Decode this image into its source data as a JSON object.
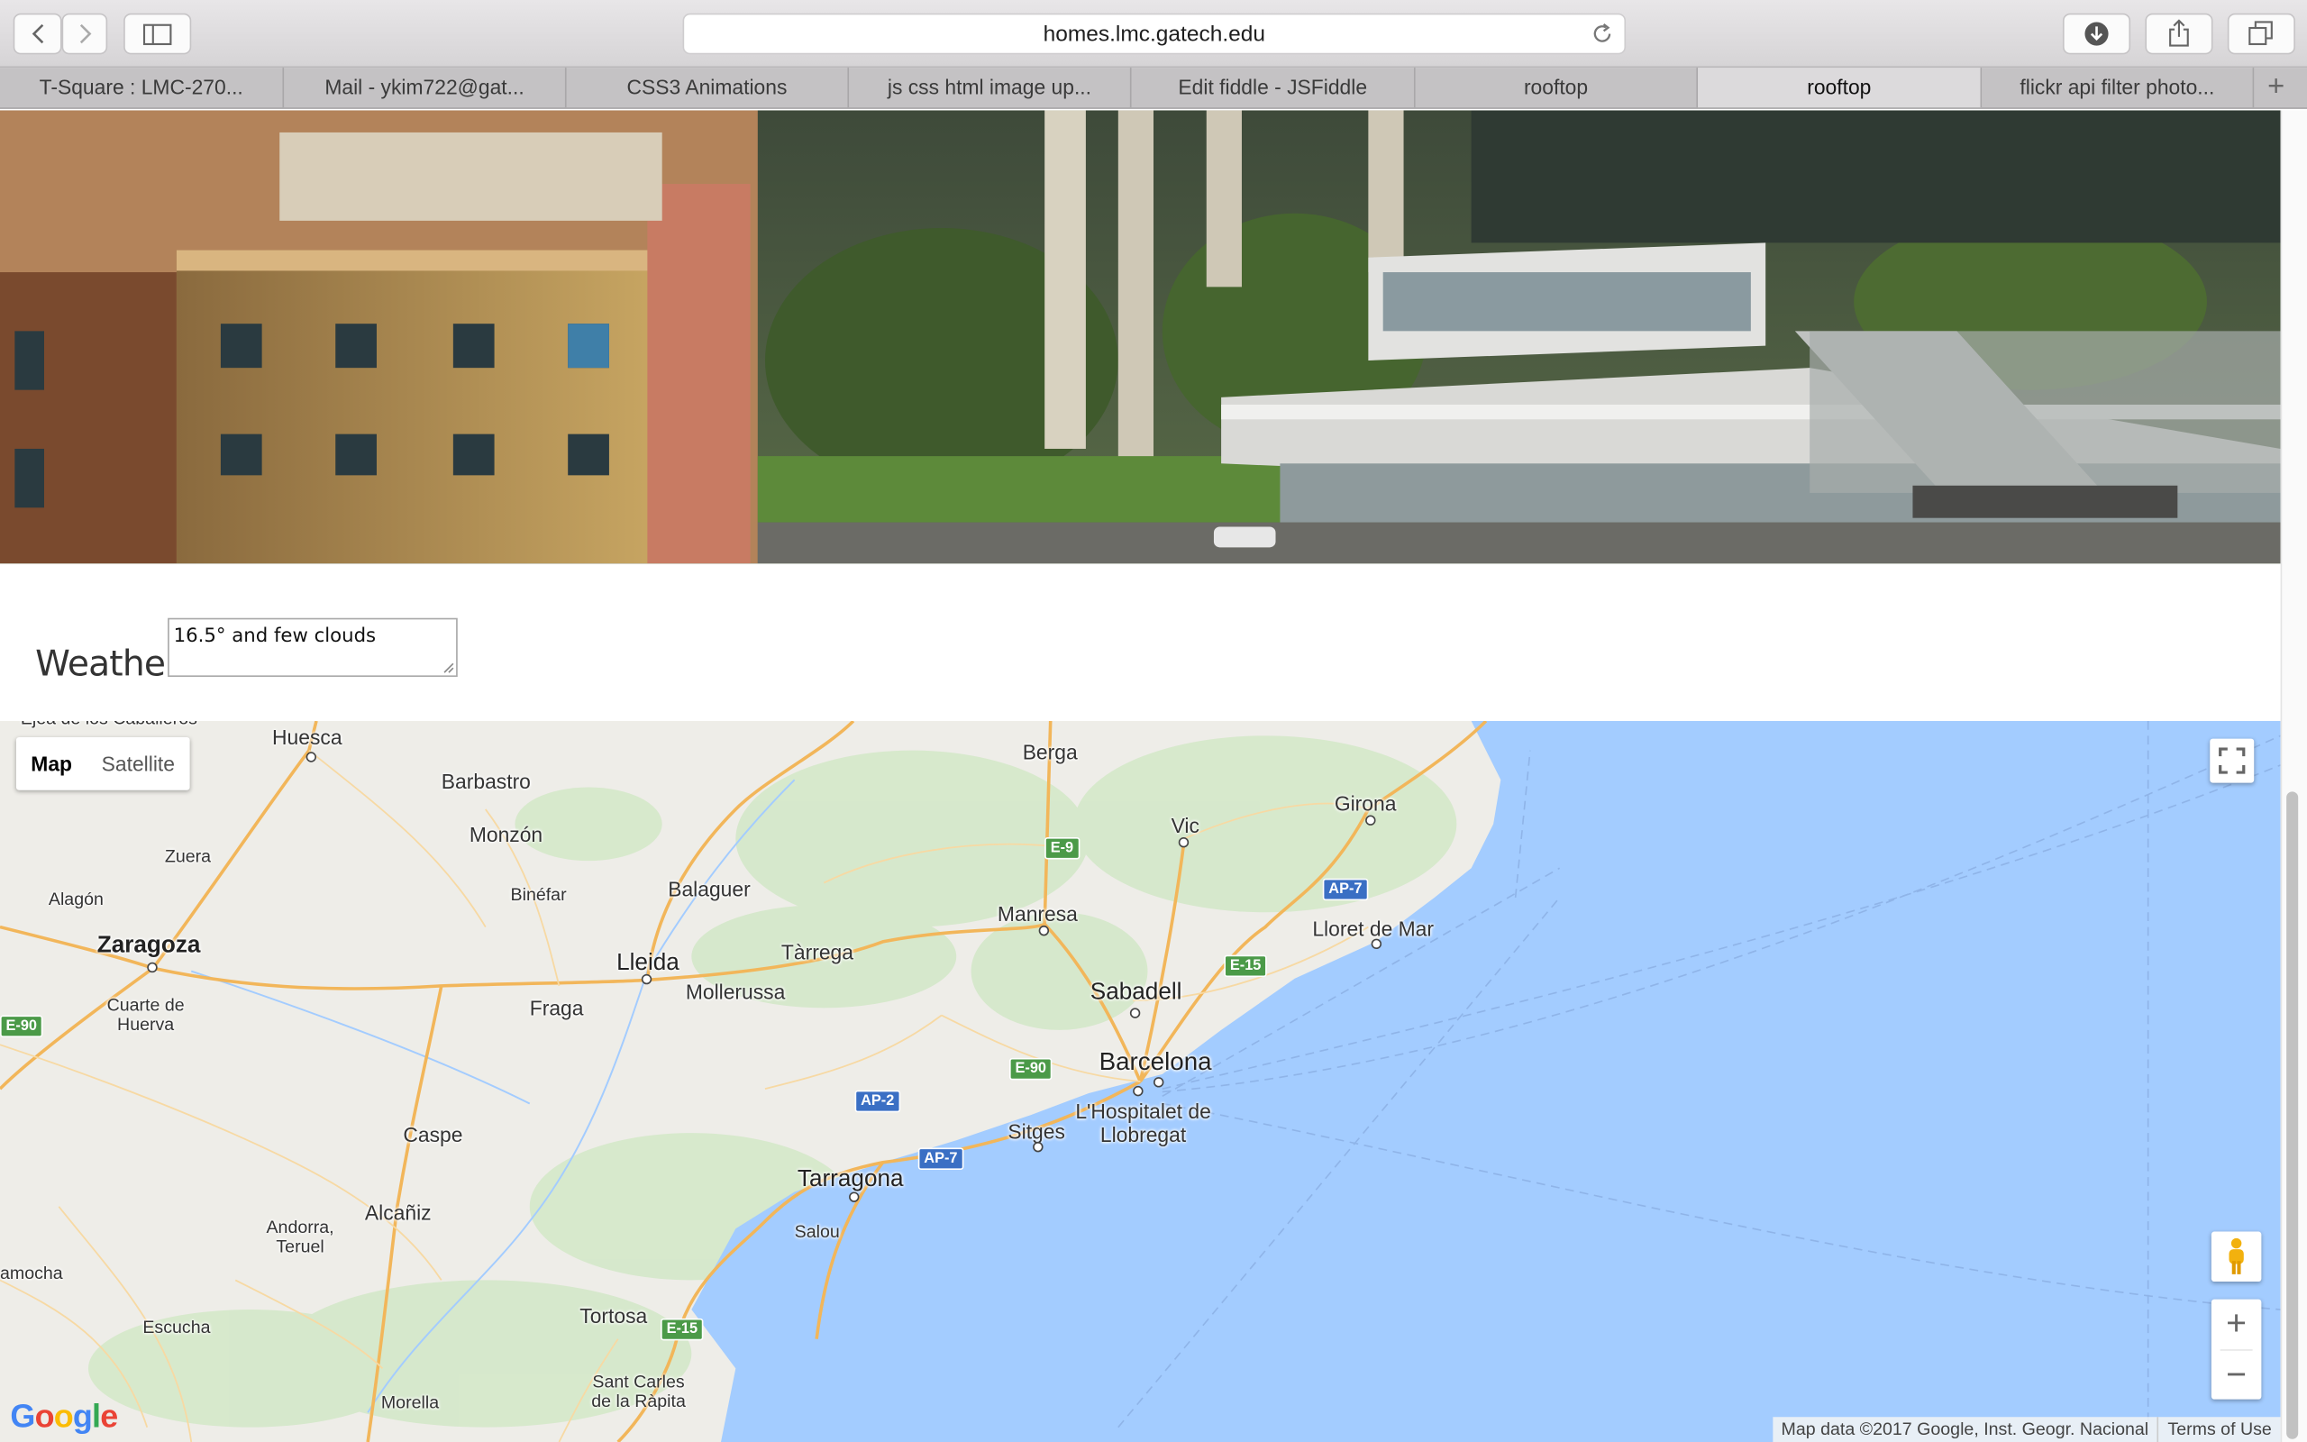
{
  "browser": {
    "url": "homes.lmc.gatech.edu",
    "tabs": [
      {
        "label": "T-Square : LMC-270...",
        "active": false
      },
      {
        "label": "Mail - ykim722@gat...",
        "active": false
      },
      {
        "label": "CSS3 Animations",
        "active": false
      },
      {
        "label": "js css html image up...",
        "active": false
      },
      {
        "label": "Edit fiddle - JSFiddle",
        "active": false
      },
      {
        "label": "rooftop",
        "active": false
      },
      {
        "label": "rooftop",
        "active": true
      },
      {
        "label": "flickr api filter photo...",
        "active": false
      }
    ],
    "new_tab_label": "+"
  },
  "weather": {
    "label": "Weather:",
    "value": "16.5° and few clouds"
  },
  "map": {
    "type_controls": {
      "map": "Map",
      "satellite": "Satellite"
    },
    "zoom_in": "+",
    "zoom_out": "−",
    "attribution": "Map data ©2017 Google, Inst. Geogr. Nacional",
    "terms": "Terms of Use",
    "logo": "Google",
    "places": [
      {
        "id": "ejea",
        "name": "Ejea de los Caballeros"
      },
      {
        "id": "huesca",
        "name": "Huesca"
      },
      {
        "id": "barbastro",
        "name": "Barbastro"
      },
      {
        "id": "monzon",
        "name": "Monzón"
      },
      {
        "id": "zuera",
        "name": "Zuera"
      },
      {
        "id": "alagon",
        "name": "Alagón"
      },
      {
        "id": "binefar",
        "name": "Binéfar"
      },
      {
        "id": "balaguer",
        "name": "Balaguer"
      },
      {
        "id": "berga",
        "name": "Berga"
      },
      {
        "id": "vic",
        "name": "Vic"
      },
      {
        "id": "girona",
        "name": "Girona"
      },
      {
        "id": "zaragoza",
        "name": "Zaragoza"
      },
      {
        "id": "lleida",
        "name": "Lleida"
      },
      {
        "id": "tarrega",
        "name": "Tàrrega"
      },
      {
        "id": "manresa",
        "name": "Manresa"
      },
      {
        "id": "lloret",
        "name": "Lloret de Mar"
      },
      {
        "id": "cuarte",
        "name": "Cuarte de Huerva"
      },
      {
        "id": "fraga",
        "name": "Fraga"
      },
      {
        "id": "mollerussa",
        "name": "Mollerussa"
      },
      {
        "id": "sabadell",
        "name": "Sabadell"
      },
      {
        "id": "barcelona",
        "name": "Barcelona"
      },
      {
        "id": "hospitalet",
        "name": "L'Hospitalet de Llobregat"
      },
      {
        "id": "sitges",
        "name": "Sitges"
      },
      {
        "id": "caspe",
        "name": "Caspe"
      },
      {
        "id": "tarragona",
        "name": "Tarragona"
      },
      {
        "id": "salou",
        "name": "Salou"
      },
      {
        "id": "alcaniz",
        "name": "Alcañiz"
      },
      {
        "id": "andorra",
        "name": "Andorra, Teruel"
      },
      {
        "id": "amocha",
        "name": "amocha"
      },
      {
        "id": "tortosa",
        "name": "Tortosa"
      },
      {
        "id": "escucha",
        "name": "Escucha"
      },
      {
        "id": "morella",
        "name": "Morella"
      },
      {
        "id": "santcarles",
        "name": "Sant Carles de la Ràpita"
      }
    ],
    "road_shields": [
      {
        "id": "e9",
        "label": "E-9",
        "color": "#4b9a48"
      },
      {
        "id": "ap7a",
        "label": "AP-7",
        "color": "#3a6fc4"
      },
      {
        "id": "e15a",
        "label": "E-15",
        "color": "#4b9a48"
      },
      {
        "id": "e90a",
        "label": "E-90",
        "color": "#4b9a48"
      },
      {
        "id": "e90b",
        "label": "E-90",
        "color": "#4b9a48"
      },
      {
        "id": "ap2",
        "label": "AP-2",
        "color": "#3a6fc4"
      },
      {
        "id": "ap7b",
        "label": "AP-7",
        "color": "#3a6fc4"
      },
      {
        "id": "e15b",
        "label": "E-15",
        "color": "#4b9a48"
      }
    ]
  },
  "colors": {
    "sea": "#a3ccff",
    "land": "#eeede8",
    "highway": "#f2b65a",
    "vegetation": "#cfe6c4"
  }
}
